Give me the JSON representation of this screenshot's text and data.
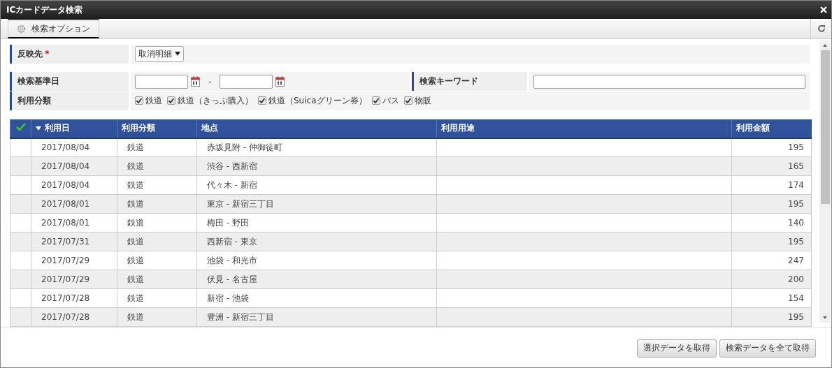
{
  "window": {
    "title": "ICカードデータ検索"
  },
  "toolbar": {
    "tab": "検索オプション"
  },
  "form": {
    "target": {
      "label": "反映先",
      "required_mark": "*",
      "value": "取消明細"
    },
    "date": {
      "label": "検索基準日",
      "separator": "-"
    },
    "keyword": {
      "label": "検索キーワード"
    },
    "category": {
      "label": "利用分類",
      "options": [
        {
          "label": "鉄道",
          "checked": true
        },
        {
          "label": "鉄道（きっぷ購入）",
          "checked": true
        },
        {
          "label": "鉄道（Suicaグリーン券）",
          "checked": true
        },
        {
          "label": "バス",
          "checked": true
        },
        {
          "label": "物販",
          "checked": true
        }
      ]
    }
  },
  "table": {
    "columns": [
      {
        "kind": "check"
      },
      {
        "kind": "text",
        "label": "利用日",
        "sorted": true
      },
      {
        "kind": "text",
        "label": "利用分類",
        "sorted": false
      },
      {
        "kind": "text",
        "label": "地点",
        "sorted": false
      },
      {
        "kind": "text",
        "label": "利用用途",
        "sorted": false
      },
      {
        "kind": "number",
        "label": "利用金額",
        "sorted": false
      }
    ],
    "rows": [
      [
        "",
        "2017/08/04",
        "鉄道",
        "赤坂見附 - 仲御徒町",
        "",
        "195"
      ],
      [
        "",
        "2017/08/04",
        "鉄道",
        "渋谷 - 西新宿",
        "",
        "165"
      ],
      [
        "",
        "2017/08/04",
        "鉄道",
        "代々木 - 新宿",
        "",
        "174"
      ],
      [
        "",
        "2017/08/01",
        "鉄道",
        "東京 - 新宿三丁目",
        "",
        "195"
      ],
      [
        "",
        "2017/08/01",
        "鉄道",
        "梅田 - 野田",
        "",
        "140"
      ],
      [
        "",
        "2017/07/31",
        "鉄道",
        "西新宿 - 東京",
        "",
        "195"
      ],
      [
        "",
        "2017/07/29",
        "鉄道",
        "池袋 - 和光市",
        "",
        "247"
      ],
      [
        "",
        "2017/07/29",
        "鉄道",
        "伏見 - 名古屋",
        "",
        "200"
      ],
      [
        "",
        "2017/07/28",
        "鉄道",
        "新宿 - 池袋",
        "",
        "154"
      ],
      [
        "",
        "2017/07/28",
        "鉄道",
        "豊洲 - 新宿三丁目",
        "",
        "195"
      ]
    ]
  },
  "buttons": [
    "選択データを取得",
    "検索データを全て取得"
  ]
}
